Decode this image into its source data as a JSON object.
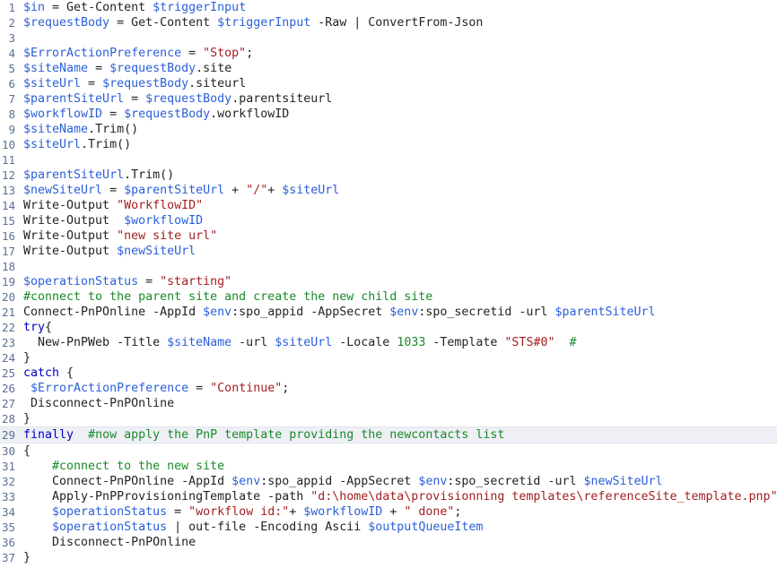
{
  "editor": {
    "language": "PowerShell",
    "current_line": 29,
    "total_lines": 37,
    "colors": {
      "background": "#ffffff",
      "text": "#232323",
      "variable": "#2b5fd9",
      "string": "#a52020",
      "comment": "#1a8a28",
      "keyword": "#0000c0",
      "number": "#1a8a28",
      "gutter": "#5c6f96",
      "current_line_highlight": "#eef0f6"
    }
  },
  "lines": [
    {
      "num": "1",
      "tokens": [
        {
          "t": "var",
          "v": "$in"
        },
        {
          "t": "plain",
          "v": " = Get-Content "
        },
        {
          "t": "var",
          "v": "$triggerInput"
        }
      ]
    },
    {
      "num": "2",
      "tokens": [
        {
          "t": "var",
          "v": "$requestBody"
        },
        {
          "t": "plain",
          "v": " = Get-Content "
        },
        {
          "t": "var",
          "v": "$triggerInput"
        },
        {
          "t": "plain",
          "v": " -Raw | ConvertFrom-Json"
        }
      ]
    },
    {
      "num": "3",
      "tokens": []
    },
    {
      "num": "4",
      "tokens": [
        {
          "t": "var",
          "v": "$ErrorActionPreference"
        },
        {
          "t": "plain",
          "v": " = "
        },
        {
          "t": "str",
          "v": "\"Stop\""
        },
        {
          "t": "plain",
          "v": ";"
        }
      ]
    },
    {
      "num": "5",
      "tokens": [
        {
          "t": "var",
          "v": "$siteName"
        },
        {
          "t": "plain",
          "v": " = "
        },
        {
          "t": "var",
          "v": "$requestBody"
        },
        {
          "t": "plain",
          "v": ".site"
        }
      ]
    },
    {
      "num": "6",
      "tokens": [
        {
          "t": "var",
          "v": "$siteUrl"
        },
        {
          "t": "plain",
          "v": " = "
        },
        {
          "t": "var",
          "v": "$requestBody"
        },
        {
          "t": "plain",
          "v": ".siteurl"
        }
      ]
    },
    {
      "num": "7",
      "tokens": [
        {
          "t": "var",
          "v": "$parentSiteUrl"
        },
        {
          "t": "plain",
          "v": " = "
        },
        {
          "t": "var",
          "v": "$requestBody"
        },
        {
          "t": "plain",
          "v": ".parentsiteurl"
        }
      ]
    },
    {
      "num": "8",
      "tokens": [
        {
          "t": "var",
          "v": "$workflowID"
        },
        {
          "t": "plain",
          "v": " = "
        },
        {
          "t": "var",
          "v": "$requestBody"
        },
        {
          "t": "plain",
          "v": ".workflowID"
        }
      ]
    },
    {
      "num": "9",
      "tokens": [
        {
          "t": "var",
          "v": "$siteName"
        },
        {
          "t": "plain",
          "v": ".Trim()"
        }
      ]
    },
    {
      "num": "10",
      "tokens": [
        {
          "t": "var",
          "v": "$siteUrl"
        },
        {
          "t": "plain",
          "v": ".Trim()"
        }
      ]
    },
    {
      "num": "11",
      "tokens": []
    },
    {
      "num": "12",
      "tokens": [
        {
          "t": "var",
          "v": "$parentSiteUrl"
        },
        {
          "t": "plain",
          "v": ".Trim()"
        }
      ]
    },
    {
      "num": "13",
      "tokens": [
        {
          "t": "var",
          "v": "$newSiteUrl"
        },
        {
          "t": "plain",
          "v": " = "
        },
        {
          "t": "var",
          "v": "$parentSiteUrl"
        },
        {
          "t": "plain",
          "v": " + "
        },
        {
          "t": "str",
          "v": "\"/\""
        },
        {
          "t": "plain",
          "v": "+ "
        },
        {
          "t": "var",
          "v": "$siteUrl"
        }
      ]
    },
    {
      "num": "14",
      "tokens": [
        {
          "t": "plain",
          "v": "Write-Output "
        },
        {
          "t": "str",
          "v": "\"WorkflowID\""
        }
      ]
    },
    {
      "num": "15",
      "tokens": [
        {
          "t": "plain",
          "v": "Write-Output  "
        },
        {
          "t": "var",
          "v": "$workflowID"
        }
      ]
    },
    {
      "num": "16",
      "tokens": [
        {
          "t": "plain",
          "v": "Write-Output "
        },
        {
          "t": "str",
          "v": "\"new site url\""
        }
      ]
    },
    {
      "num": "17",
      "tokens": [
        {
          "t": "plain",
          "v": "Write-Output "
        },
        {
          "t": "var",
          "v": "$newSiteUrl"
        }
      ]
    },
    {
      "num": "18",
      "tokens": []
    },
    {
      "num": "19",
      "tokens": [
        {
          "t": "var",
          "v": "$operationStatus"
        },
        {
          "t": "plain",
          "v": " = "
        },
        {
          "t": "str",
          "v": "\"starting\""
        }
      ]
    },
    {
      "num": "20",
      "tokens": [
        {
          "t": "com",
          "v": "#connect to the parent site and create the new child site"
        }
      ]
    },
    {
      "num": "21",
      "tokens": [
        {
          "t": "plain",
          "v": "Connect-PnPOnline -AppId "
        },
        {
          "t": "var",
          "v": "$env"
        },
        {
          "t": "plain",
          "v": ":spo_appid -AppSecret "
        },
        {
          "t": "var",
          "v": "$env"
        },
        {
          "t": "plain",
          "v": ":spo_secretid -url "
        },
        {
          "t": "var",
          "v": "$parentSiteUrl"
        }
      ]
    },
    {
      "num": "22",
      "tokens": [
        {
          "t": "kw",
          "v": "try"
        },
        {
          "t": "plain",
          "v": "{"
        }
      ]
    },
    {
      "num": "23",
      "tokens": [
        {
          "t": "plain",
          "v": "  New-PnPWeb -Title "
        },
        {
          "t": "var",
          "v": "$siteName"
        },
        {
          "t": "plain",
          "v": " -url "
        },
        {
          "t": "var",
          "v": "$siteUrl"
        },
        {
          "t": "plain",
          "v": " -Locale "
        },
        {
          "t": "num",
          "v": "1033"
        },
        {
          "t": "plain",
          "v": " -Template "
        },
        {
          "t": "str",
          "v": "\"STS#0\""
        },
        {
          "t": "plain",
          "v": "  "
        },
        {
          "t": "com",
          "v": "#"
        }
      ]
    },
    {
      "num": "24",
      "tokens": [
        {
          "t": "plain",
          "v": "}"
        }
      ]
    },
    {
      "num": "25",
      "tokens": [
        {
          "t": "kw",
          "v": "catch"
        },
        {
          "t": "plain",
          "v": " {"
        }
      ]
    },
    {
      "num": "26",
      "tokens": [
        {
          "t": "plain",
          "v": " "
        },
        {
          "t": "var",
          "v": "$ErrorActionPreference"
        },
        {
          "t": "plain",
          "v": " = "
        },
        {
          "t": "str",
          "v": "\"Continue\""
        },
        {
          "t": "plain",
          "v": ";"
        }
      ]
    },
    {
      "num": "27",
      "tokens": [
        {
          "t": "plain",
          "v": " Disconnect-PnPOnline"
        }
      ]
    },
    {
      "num": "28",
      "tokens": [
        {
          "t": "plain",
          "v": "}"
        }
      ]
    },
    {
      "num": "29",
      "tokens": [
        {
          "t": "kw",
          "v": "finally"
        },
        {
          "t": "plain",
          "v": "  "
        },
        {
          "t": "com",
          "v": "#now apply the PnP template providing the newcontacts list"
        }
      ],
      "current": true
    },
    {
      "num": "30",
      "tokens": [
        {
          "t": "plain",
          "v": "{"
        }
      ]
    },
    {
      "num": "31",
      "tokens": [
        {
          "t": "com",
          "v": "    #connect to the new site"
        }
      ]
    },
    {
      "num": "32",
      "tokens": [
        {
          "t": "plain",
          "v": "    Connect-PnPOnline -AppId "
        },
        {
          "t": "var",
          "v": "$env"
        },
        {
          "t": "plain",
          "v": ":spo_appid -AppSecret "
        },
        {
          "t": "var",
          "v": "$env"
        },
        {
          "t": "plain",
          "v": ":spo_secretid -url "
        },
        {
          "t": "var",
          "v": "$newSiteUrl"
        }
      ]
    },
    {
      "num": "33",
      "tokens": [
        {
          "t": "plain",
          "v": "    Apply-PnPProvisioningTemplate -path "
        },
        {
          "t": "str",
          "v": "\"d:\\home\\data\\provisionning templates\\referenceSite_template.pnp\""
        }
      ]
    },
    {
      "num": "34",
      "tokens": [
        {
          "t": "plain",
          "v": "    "
        },
        {
          "t": "var",
          "v": "$operationStatus"
        },
        {
          "t": "plain",
          "v": " = "
        },
        {
          "t": "str",
          "v": "\"workflow id:\""
        },
        {
          "t": "plain",
          "v": "+ "
        },
        {
          "t": "var",
          "v": "$workflowID"
        },
        {
          "t": "plain",
          "v": " + "
        },
        {
          "t": "str",
          "v": "\" done\""
        },
        {
          "t": "plain",
          "v": ";"
        }
      ]
    },
    {
      "num": "35",
      "tokens": [
        {
          "t": "plain",
          "v": "    "
        },
        {
          "t": "var",
          "v": "$operationStatus"
        },
        {
          "t": "plain",
          "v": " | out-file -Encoding Ascii "
        },
        {
          "t": "var",
          "v": "$outputQueueItem"
        }
      ]
    },
    {
      "num": "36",
      "tokens": [
        {
          "t": "plain",
          "v": "    Disconnect-PnPOnline"
        }
      ]
    },
    {
      "num": "37",
      "tokens": [
        {
          "t": "plain",
          "v": "}"
        }
      ]
    }
  ]
}
